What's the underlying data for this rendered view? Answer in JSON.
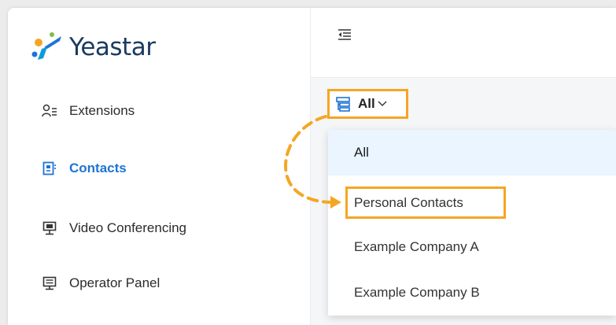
{
  "brand": {
    "name": "Yeastar",
    "accent": "#1e74d3",
    "highlight": "#f5a623"
  },
  "sidebar": {
    "items": [
      {
        "label": "Extensions",
        "icon": "user-list-icon",
        "active": false
      },
      {
        "label": "Contacts",
        "icon": "contacts-book-icon",
        "active": true
      },
      {
        "label": "Video Conferencing",
        "icon": "monitor-icon",
        "active": false
      },
      {
        "label": "Operator Panel",
        "icon": "operator-panel-icon",
        "active": false
      }
    ]
  },
  "toolbar": {
    "collapse_icon": "collapse-menu-icon"
  },
  "filter": {
    "label": "All",
    "icon": "filter-tree-icon",
    "chevron": "chevron-down-icon"
  },
  "dropdown": {
    "options": [
      {
        "label": "All",
        "selected": true
      },
      {
        "label": "Personal Contacts",
        "selected": false
      },
      {
        "label": "Example Company A",
        "selected": false
      },
      {
        "label": "Example Company B",
        "selected": false
      }
    ]
  }
}
